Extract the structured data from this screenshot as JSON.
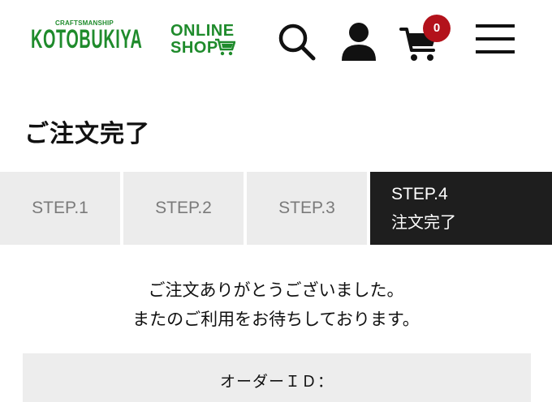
{
  "header": {
    "logo": {
      "craftsmanship": "CRAFTSMANSHIP",
      "brand": "KOTOBUKIYA",
      "online": "ONLINE",
      "shop": "SHOP"
    },
    "icons": [
      "search-icon",
      "user-icon",
      "cart-icon",
      "menu-icon"
    ],
    "cart_count": "0",
    "colors": {
      "brand_green": "#1f8b2c",
      "badge_red": "#b3121b"
    }
  },
  "page": {
    "title": "ご注文完了"
  },
  "steps": [
    {
      "label": "STEP.1"
    },
    {
      "label": "STEP.2"
    },
    {
      "label": "STEP.3"
    },
    {
      "label": "STEP.4",
      "sub": "注文完了",
      "active": true
    }
  ],
  "message": {
    "line1": "ご注文ありがとうございました。",
    "line2": "またのご利用をお待ちしております。"
  },
  "order": {
    "id_label": "オーダーＩＤ："
  }
}
